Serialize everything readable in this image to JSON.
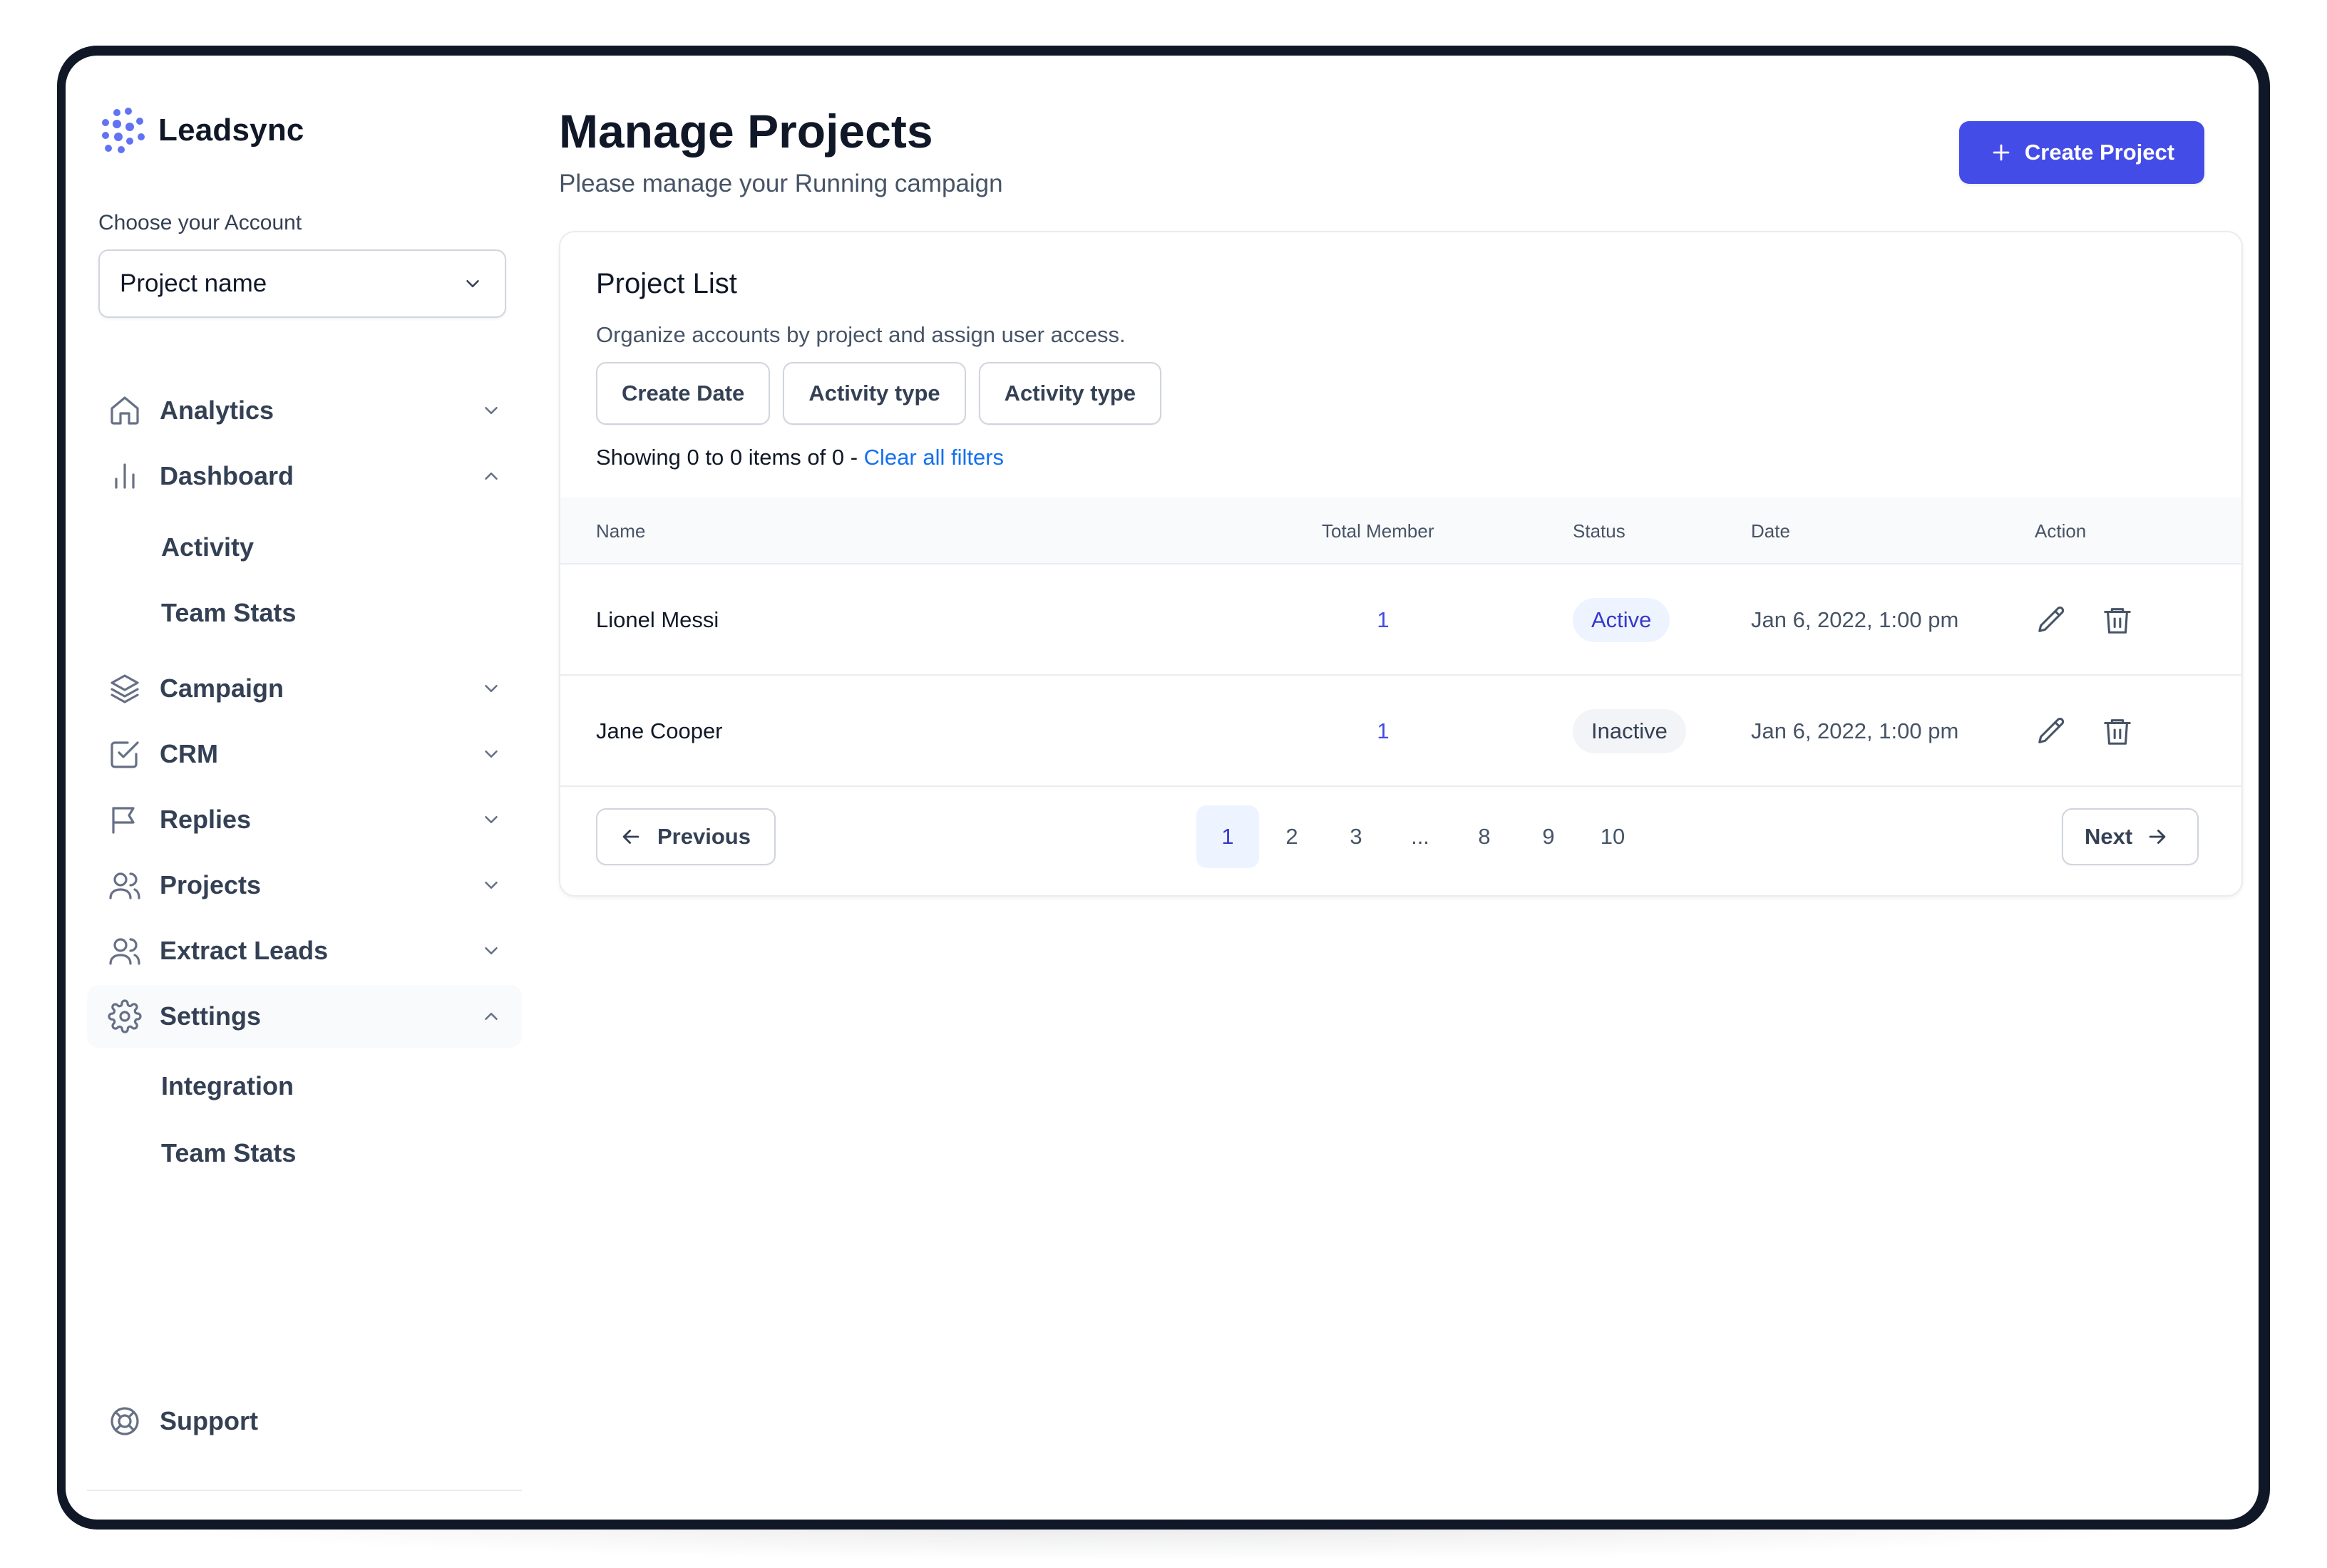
{
  "brand": {
    "name": "Leadsync",
    "logo_icon": "dots-logo-icon",
    "accent": "#6172f3"
  },
  "account": {
    "label": "Choose your Account",
    "selected": "Project name"
  },
  "nav": {
    "items": [
      {
        "label": "Analytics",
        "icon": "home-icon",
        "expanded": false
      },
      {
        "label": "Dashboard",
        "icon": "bar-chart-icon",
        "expanded": true,
        "children": [
          "Activity",
          "Team Stats"
        ]
      },
      {
        "label": "Campaign",
        "icon": "layers-icon",
        "expanded": false
      },
      {
        "label": "CRM",
        "icon": "check-square-icon",
        "expanded": false
      },
      {
        "label": "Replies",
        "icon": "flag-icon",
        "expanded": false
      },
      {
        "label": "Projects",
        "icon": "users-icon",
        "expanded": false
      },
      {
        "label": "Extract Leads",
        "icon": "users-icon",
        "expanded": false
      },
      {
        "label": "Settings",
        "icon": "gear-icon",
        "expanded": true,
        "active": true,
        "children": [
          "Integration",
          "Team Stats"
        ]
      }
    ],
    "support": {
      "label": "Support",
      "icon": "life-buoy-icon"
    }
  },
  "header": {
    "title": "Manage Projects",
    "subtitle": "Please manage your Running campaign",
    "create_button": "Create Project"
  },
  "card": {
    "title": "Project List",
    "subtitle": "Organize accounts by project and assign user access.",
    "filters": [
      "Create Date",
      "Activity type",
      "Activity type"
    ],
    "showing_text": "Showing 0 to 0 items of 0 - ",
    "clear_link": "Clear all filters",
    "columns": [
      "Name",
      "Total Member",
      "Status",
      "Date",
      "Action"
    ],
    "rows": [
      {
        "name": "Lionel Messi",
        "members": "1",
        "status": "Active",
        "date": "Jan 6, 2022, 1:00 pm"
      },
      {
        "name": "Jane Cooper",
        "members": "1",
        "status": "Inactive",
        "date": "Jan 6, 2022, 1:00 pm"
      }
    ]
  },
  "pagination": {
    "previous": "Previous",
    "next": "Next",
    "pages": [
      "1",
      "2",
      "3",
      "...",
      "8",
      "9",
      "10"
    ],
    "current": "1"
  },
  "colors": {
    "primary": "#444ce7",
    "active_badge_bg": "#eef4ff",
    "active_badge_text": "#3538cd",
    "inactive_badge_bg": "#f2f4f7",
    "link": "#1570ef",
    "frame": "#101828"
  }
}
